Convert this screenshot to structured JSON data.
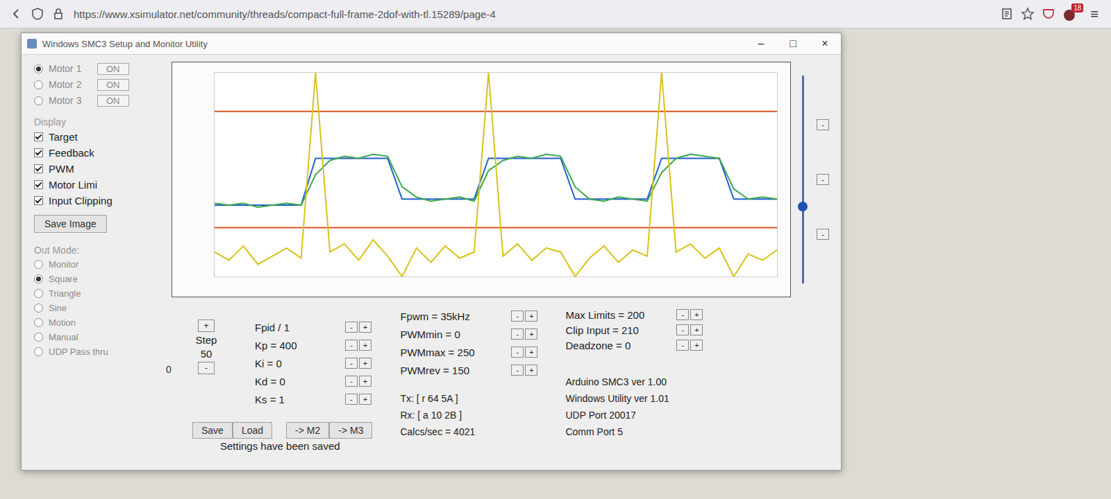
{
  "browser": {
    "url": "https://www.xsimulator.net/community/threads/compact-full-frame-2dof-with-tl.15289/page-4",
    "badge": "18",
    "menu": "≡"
  },
  "window": {
    "title": "Windows SMC3 Setup and Monitor Utility",
    "controls": [
      "–",
      "□",
      "×"
    ]
  },
  "motors": [
    {
      "label": "Motor 1",
      "state": "ON",
      "selected": true
    },
    {
      "label": "Motor 2",
      "state": "ON",
      "selected": false
    },
    {
      "label": "Motor 3",
      "state": "ON",
      "selected": false
    }
  ],
  "display": {
    "heading": "Display",
    "items": [
      {
        "label": "Target",
        "checked": true
      },
      {
        "label": "Feedback",
        "checked": true
      },
      {
        "label": "PWM",
        "checked": true
      },
      {
        "label": "Motor Limi",
        "checked": true
      },
      {
        "label": "Input Clipping",
        "checked": true
      }
    ]
  },
  "save_image": "Save Image",
  "out_mode": {
    "heading": "Out Mode:",
    "items": [
      {
        "label": "Monitor",
        "selected": false
      },
      {
        "label": "Square",
        "selected": true
      },
      {
        "label": "Triangle",
        "selected": false
      },
      {
        "label": "Sine",
        "selected": false
      },
      {
        "label": "Motion",
        "selected": false
      },
      {
        "label": "Manual",
        "selected": false
      },
      {
        "label": "UDP Pass thru",
        "selected": false
      }
    ]
  },
  "counter": "0",
  "step": {
    "plus": "+",
    "label": "Step",
    "value": "50",
    "minus": "-"
  },
  "adjust": {
    "minus": "-",
    "plus": "+"
  },
  "pid": [
    "Fpid / 1",
    "Kp = 400",
    "Ki = 0",
    "Kd = 0",
    "Ks = 1"
  ],
  "pwm": [
    "Fpwm = 35kHz",
    "PWMmin = 0",
    "PWMmax = 250",
    "PWMrev = 150"
  ],
  "comm": [
    "Tx: [ r 64 5A ]",
    "Rx: [ a 10 2B ]",
    "Calcs/sec = 4021"
  ],
  "limits": [
    "Max Limits = 200",
    "Clip Input = 210",
    "Deadzone = 0"
  ],
  "versions": [
    "Arduino SMC3 ver 1.00",
    "Windows Utility ver 1.01",
    "UDP Port 20017",
    "Comm Port 5"
  ],
  "file_buttons": [
    "Save",
    "Load",
    "-> M2",
    "-> M3"
  ],
  "status": "Settings have been saved",
  "chart": {
    "y_min": 0,
    "y_max": 100,
    "series": [
      {
        "color": "#1f5fd0",
        "values": [
          35,
          35,
          35,
          35,
          35,
          35,
          35,
          58,
          58,
          58,
          58,
          58,
          58,
          38,
          38,
          38,
          38,
          38,
          38,
          58,
          58,
          58,
          58,
          58,
          58,
          38,
          38,
          38,
          38,
          38,
          38,
          58,
          58,
          58,
          58,
          58,
          38,
          38,
          38,
          38
        ]
      },
      {
        "color": "#3aa84a",
        "values": [
          36,
          35,
          36,
          34,
          35,
          36,
          35,
          50,
          57,
          59,
          58,
          60,
          59,
          44,
          39,
          37,
          38,
          39,
          37,
          52,
          57,
          59,
          58,
          60,
          59,
          44,
          38,
          37,
          39,
          38,
          37,
          51,
          58,
          60,
          59,
          58,
          43,
          38,
          39,
          38
        ]
      },
      {
        "color": "#d8c21a",
        "values": [
          12,
          8,
          15,
          6,
          10,
          14,
          9,
          100,
          12,
          16,
          8,
          18,
          10,
          0,
          14,
          7,
          15,
          9,
          12,
          100,
          10,
          16,
          8,
          14,
          12,
          0,
          9,
          15,
          7,
          13,
          10,
          100,
          12,
          16,
          9,
          14,
          0,
          11,
          8,
          13
        ]
      }
    ],
    "limit_lines": [
      {
        "value": 81,
        "color": "#d9541e"
      },
      {
        "value": 24,
        "color": "#d9541e"
      }
    ]
  },
  "scale_slider": {
    "level": 0.37,
    "buttons": [
      "-",
      "-",
      "-"
    ]
  }
}
